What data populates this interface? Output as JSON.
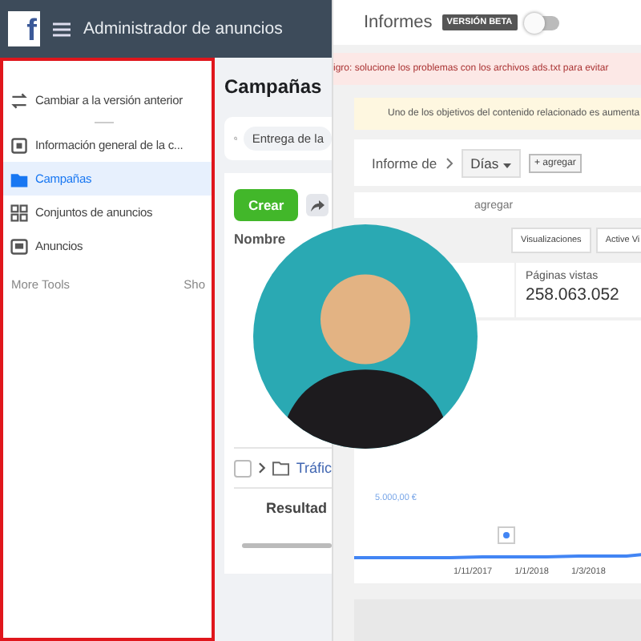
{
  "left": {
    "logo": "f",
    "title": "Administrador de anuncios",
    "sidebar": {
      "items": [
        {
          "label": "Cambiar a la versión anterior",
          "selected": false
        },
        {
          "label": "Información general de la c...",
          "selected": false
        },
        {
          "label": "Campañas",
          "selected": true
        },
        {
          "label": "Conjuntos de anuncios",
          "selected": false
        },
        {
          "label": "Anuncios",
          "selected": false
        }
      ],
      "section": "More Tools",
      "section_action": "Sho"
    },
    "main": {
      "title": "Campañas",
      "search": {
        "value": "Entrega de la"
      },
      "create_button": "Crear",
      "table": {
        "header": "Nombre",
        "rows": [
          {
            "kind": "folder",
            "label": "Tráfic",
            "checked": false
          },
          {
            "kind": "result",
            "label": "Resultad"
          }
        ]
      }
    }
  },
  "right": {
    "title": "Informes",
    "badge": "VERSIÓN BETA",
    "beta_toggle": {
      "on": false
    },
    "alerts": [
      {
        "kind": "error",
        "text": "igro: solucione los problemas con los archivos ads.txt para evitar"
      },
      {
        "kind": "info",
        "text": "Uno de los objetivos del contenido relacionado es aumenta"
      }
    ],
    "report": {
      "label": "Informe de",
      "dimension": "Días",
      "add_button": "+ agregar",
      "filter_placeholder": "agregar"
    },
    "tabs": [
      {
        "label": "Visualizaciones",
        "selected": false
      },
      {
        "label": "Active Vi",
        "selected": false
      }
    ],
    "metric": {
      "label": "Páginas vistas",
      "value": "258.063.052"
    },
    "chart": {
      "y_label": "5.000,00 €",
      "x_labels": [
        "1/11/2017",
        "1/1/2018",
        "1/3/2018"
      ]
    }
  }
}
